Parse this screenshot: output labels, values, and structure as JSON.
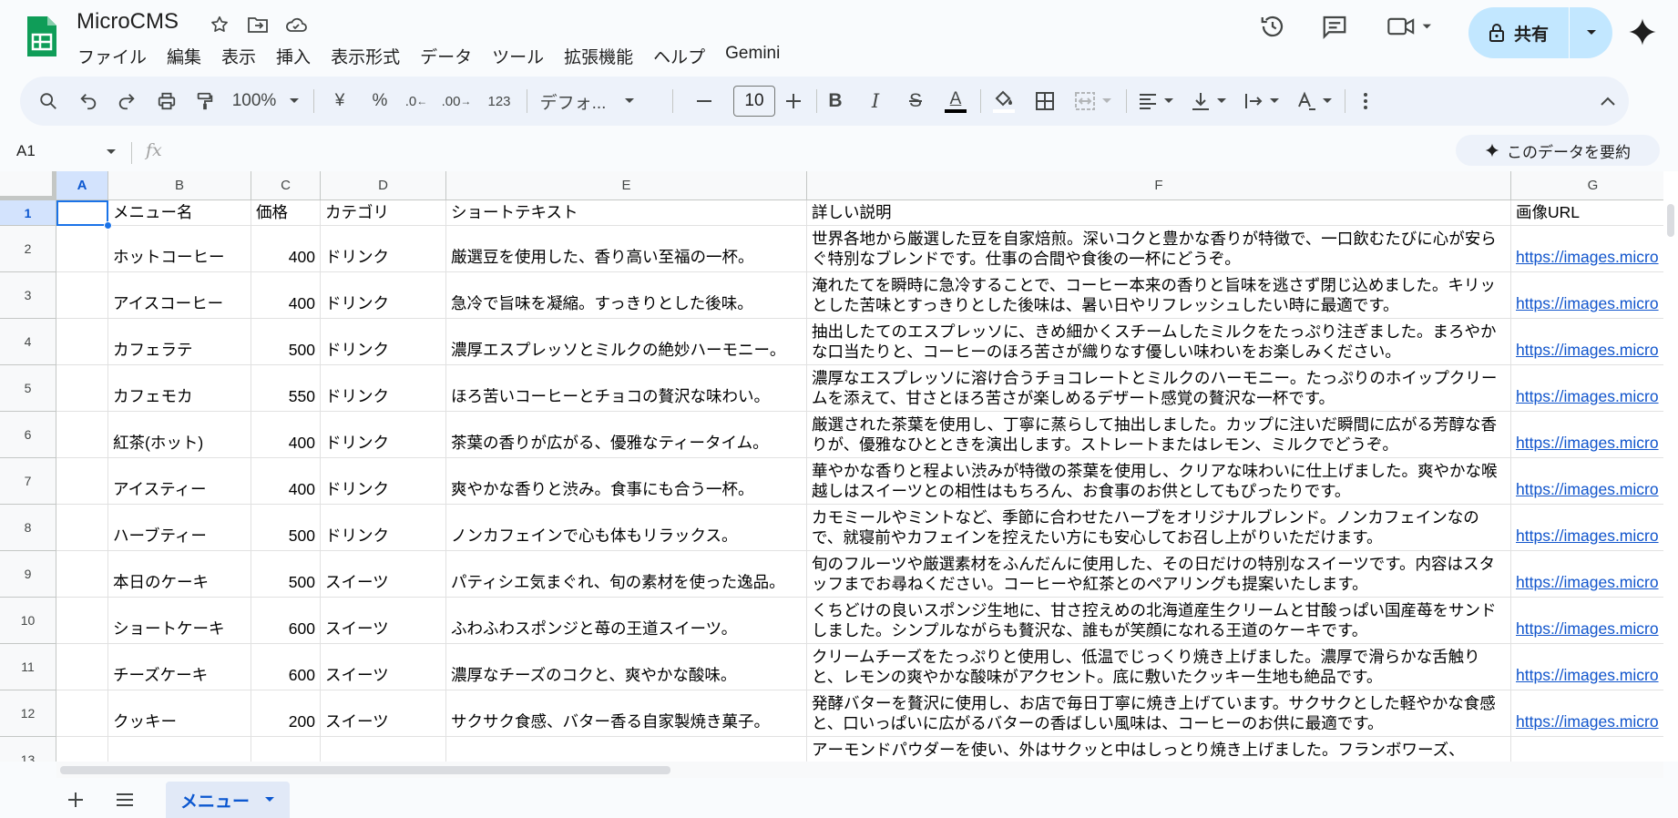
{
  "header": {
    "doc_title": "MicroCMS",
    "menu": [
      "ファイル",
      "編集",
      "表示",
      "挿入",
      "表示形式",
      "データ",
      "ツール",
      "拡張機能",
      "ヘルプ",
      "Gemini"
    ],
    "share_label": "共有"
  },
  "toolbar": {
    "zoom": "100%",
    "currency": "¥",
    "percent": "%",
    "dec_less": ".0",
    "dec_more": ".00",
    "number_format": "123",
    "font_name": "デフォ...",
    "font_size": "10",
    "bold": "B",
    "italic": "I",
    "strike": "S",
    "text_color": "A"
  },
  "formula_bar": {
    "name_box": "A1",
    "fx": "fx",
    "summarize": "このデータを要約"
  },
  "columns": [
    "A",
    "B",
    "C",
    "D",
    "E",
    "F",
    "G"
  ],
  "header_row": {
    "row_num": "1",
    "cells": [
      "",
      "メニュー名",
      "価格",
      "カテゴリ",
      "ショートテキスト",
      "詳しい説明",
      "画像URL"
    ]
  },
  "rows": [
    {
      "num": "2",
      "name": "ホットコーヒー",
      "price": "400",
      "category": "ドリンク",
      "short": "厳選豆を使用した、香り高い至福の一杯。",
      "detail": "世界各地から厳選した豆を自家焙煎。深いコクと豊かな香りが特徴で、一口飲むたびに心が安らぐ特別なブレンドです。仕事の合間や食後の一杯にどうぞ。",
      "url": "https://images.micro"
    },
    {
      "num": "3",
      "name": "アイスコーヒー",
      "price": "400",
      "category": "ドリンク",
      "short": "急冷で旨味を凝縮。すっきりとした後味。",
      "detail": "淹れたてを瞬時に急冷することで、コーヒー本来の香りと旨味を逃さず閉じ込めました。キリッとした苦味とすっきりとした後味は、暑い日やリフレッシュしたい時に最適です。",
      "url": "https://images.micro"
    },
    {
      "num": "4",
      "name": "カフェラテ",
      "price": "500",
      "category": "ドリンク",
      "short": "濃厚エスプレッソとミルクの絶妙ハーモニー。",
      "detail": "抽出したてのエスプレッソに、きめ細かくスチームしたミルクをたっぷり注ぎました。まろやかな口当たりと、コーヒーのほろ苦さが織りなす優しい味わいをお楽しみください。",
      "url": "https://images.micro"
    },
    {
      "num": "5",
      "name": "カフェモカ",
      "price": "550",
      "category": "ドリンク",
      "short": "ほろ苦いコーヒーとチョコの贅沢な味わい。",
      "detail": "濃厚なエスプレッソに溶け合うチョコレートとミルクのハーモニー。たっぷりのホイップクリームを添えて、甘さとほろ苦さが楽しめるデザート感覚の贅沢な一杯です。",
      "url": "https://images.micro"
    },
    {
      "num": "6",
      "name": "紅茶(ホット)",
      "price": "400",
      "category": "ドリンク",
      "short": "茶葉の香りが広がる、優雅なティータイム。",
      "detail": "厳選された茶葉を使用し、丁寧に蒸らして抽出しました。カップに注いだ瞬間に広がる芳醇な香りが、優雅なひとときを演出します。ストレートまたはレモン、ミルクでどうぞ。",
      "url": "https://images.micro"
    },
    {
      "num": "7",
      "name": "アイスティー",
      "price": "400",
      "category": "ドリンク",
      "short": "爽やかな香りと渋み。食事にも合う一杯。",
      "detail": "華やかな香りと程よい渋みが特徴の茶葉を使用し、クリアな味わいに仕上げました。爽やかな喉越しはスイーツとの相性はもちろん、お食事のお供としてもぴったりです。",
      "url": "https://images.micro"
    },
    {
      "num": "8",
      "name": "ハーブティー",
      "price": "500",
      "category": "ドリンク",
      "short": "ノンカフェインで心も体もリラックス。",
      "detail": "カモミールやミントなど、季節に合わせたハーブをオリジナルブレンド。ノンカフェインなので、就寝前やカフェインを控えたい方にも安心してお召し上がりいただけます。",
      "url": "https://images.micro"
    },
    {
      "num": "9",
      "name": "本日のケーキ",
      "price": "500",
      "category": "スイーツ",
      "short": "パティシエ気まぐれ、旬の素材を使った逸品。",
      "detail": "旬のフルーツや厳選素材をふんだんに使用した、その日だけの特別なスイーツです。内容はスタッフまでお尋ねください。コーヒーや紅茶とのペアリングも提案いたします。",
      "url": "https://images.micro"
    },
    {
      "num": "10",
      "name": "ショートケーキ",
      "price": "600",
      "category": "スイーツ",
      "short": "ふわふわスポンジと苺の王道スイーツ。",
      "detail": "くちどけの良いスポンジ生地に、甘さ控えめの北海道産生クリームと甘酸っぱい国産苺をサンドしました。シンプルながらも贅沢な、誰もが笑顔になれる王道のケーキです。",
      "url": "https://images.micro"
    },
    {
      "num": "11",
      "name": "チーズケーキ",
      "price": "600",
      "category": "スイーツ",
      "short": "濃厚なチーズのコクと、爽やかな酸味。",
      "detail": "クリームチーズをたっぷりと使用し、低温でじっくり焼き上げました。濃厚で滑らかな舌触りと、レモンの爽やかな酸味がアクセント。底に敷いたクッキー生地も絶品です。",
      "url": "https://images.micro"
    },
    {
      "num": "12",
      "name": "クッキー",
      "price": "200",
      "category": "スイーツ",
      "short": "サクサク食感、バター香る自家製焼き菓子。",
      "detail": "発酵バターを贅沢に使用し、お店で毎日丁寧に焼き上げています。サクサクとした軽やかな食感と、口いっぱいに広がるバターの香ばしい風味は、コーヒーのお供に最適です。",
      "url": "https://images.micro"
    },
    {
      "num": "13",
      "name": "",
      "price": "",
      "category": "",
      "short": "",
      "detail": "アーモンドパウダーを使い、外はサクッと中はしっとり焼き上げました。フランボワーズ、",
      "url": ""
    }
  ],
  "sheet_tabs": {
    "active": "メニュー"
  },
  "colors": {
    "accent": "#1a73e8",
    "share_bg": "#c2e7ff",
    "link": "#1155cc",
    "sheets_green": "#0f9d58"
  }
}
